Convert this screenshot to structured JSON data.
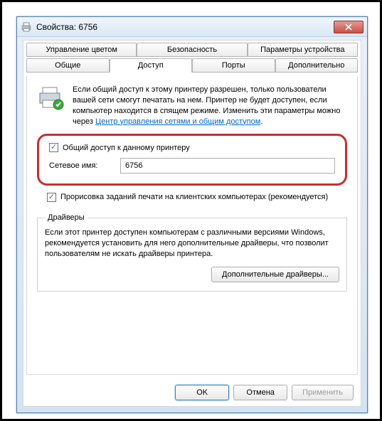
{
  "window": {
    "title": "Свойства: 6756"
  },
  "tabs": {
    "row1": [
      {
        "label": "Управление цветом"
      },
      {
        "label": "Безопасность"
      },
      {
        "label": "Параметры устройства"
      }
    ],
    "row2": [
      {
        "label": "Общие"
      },
      {
        "label": "Доступ",
        "active": true
      },
      {
        "label": "Порты"
      },
      {
        "label": "Дополнительно"
      }
    ]
  },
  "info": {
    "text1": "Если общий доступ к этому принтеру разрешен, только пользователи вашей сети смогут печатать на нем. Принтер не будет доступен, если компьютер находится в спящем режиме. Изменить эти параметры можно через ",
    "link": "Центр управления сетями и общим доступом",
    "text_end": "."
  },
  "share": {
    "checkbox_label": "Общий доступ к данному принтеру",
    "checked": true,
    "name_label": "Сетевое имя:",
    "name_value": "6756"
  },
  "render": {
    "checkbox_label": "Прорисовка заданий печати на клиентских компьютерах (рекомендуется)",
    "checked": true
  },
  "drivers": {
    "legend": "Драйверы",
    "text": "Если этот принтер доступен компьютерам с различными версиями Windows, рекомендуется установить для него дополнительные драйверы, что позволит пользователям не искать драйверы принтера.",
    "button": "Дополнительные драйверы..."
  },
  "buttons": {
    "ok": "OK",
    "cancel": "Отмена",
    "apply": "Применить"
  },
  "icons": {
    "printer": "printer-icon",
    "close": "close-icon"
  }
}
